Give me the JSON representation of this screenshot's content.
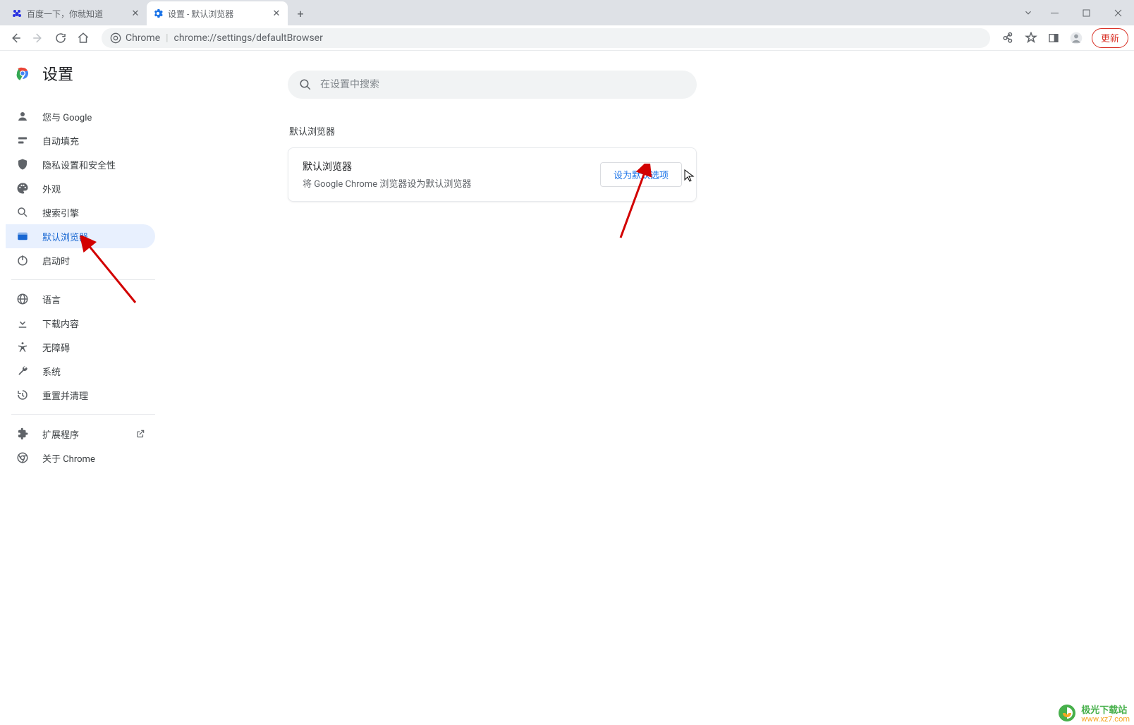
{
  "tabs": [
    {
      "title": "百度一下，你就知道"
    },
    {
      "title": "设置 - 默认浏览器"
    }
  ],
  "omnibox": {
    "badge": "Chrome",
    "url": "chrome://settings/defaultBrowser"
  },
  "toolbar": {
    "update_label": "更新"
  },
  "settings": {
    "title": "设置",
    "search_placeholder": "在设置中搜索"
  },
  "sidebar": {
    "items": [
      {
        "label": "您与 Google"
      },
      {
        "label": "自动填充"
      },
      {
        "label": "隐私设置和安全性"
      },
      {
        "label": "外观"
      },
      {
        "label": "搜索引擎"
      },
      {
        "label": "默认浏览器"
      },
      {
        "label": "启动时"
      }
    ],
    "items2": [
      {
        "label": "语言"
      },
      {
        "label": "下载内容"
      },
      {
        "label": "无障碍"
      },
      {
        "label": "系统"
      },
      {
        "label": "重置并清理"
      }
    ],
    "items3": [
      {
        "label": "扩展程序"
      },
      {
        "label": "关于 Chrome"
      }
    ]
  },
  "main": {
    "section_title": "默认浏览器",
    "card_title": "默认浏览器",
    "card_sub": "将 Google Chrome 浏览器设为默认浏览器",
    "card_btn": "设为默认选项"
  },
  "watermark": {
    "line1": "极光下载站",
    "line2": "www.xz7.com"
  }
}
